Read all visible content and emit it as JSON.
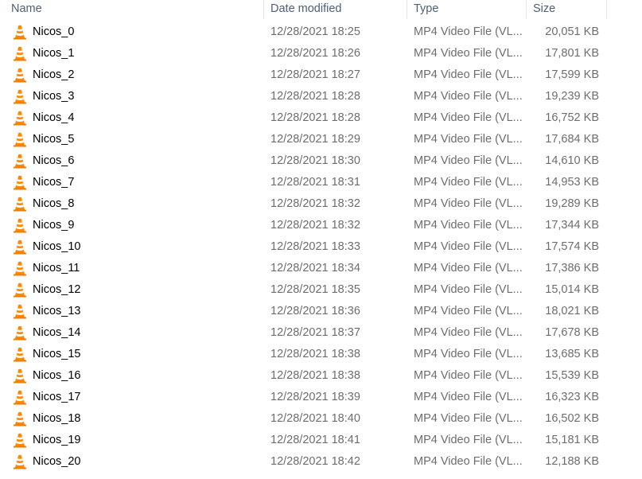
{
  "columns": {
    "name": "Name",
    "date": "Date modified",
    "type": "Type",
    "size": "Size"
  },
  "icon": "vlc-cone-icon",
  "files": [
    {
      "name": "Nicos_0",
      "date": "12/28/2021 18:25",
      "type": "MP4 Video File (VL...",
      "size": "20,051 KB"
    },
    {
      "name": "Nicos_1",
      "date": "12/28/2021 18:26",
      "type": "MP4 Video File (VL...",
      "size": "17,801 KB"
    },
    {
      "name": "Nicos_2",
      "date": "12/28/2021 18:27",
      "type": "MP4 Video File (VL...",
      "size": "17,599 KB"
    },
    {
      "name": "Nicos_3",
      "date": "12/28/2021 18:28",
      "type": "MP4 Video File (VL...",
      "size": "19,239 KB"
    },
    {
      "name": "Nicos_4",
      "date": "12/28/2021 18:28",
      "type": "MP4 Video File (VL...",
      "size": "16,752 KB"
    },
    {
      "name": "Nicos_5",
      "date": "12/28/2021 18:29",
      "type": "MP4 Video File (VL...",
      "size": "17,684 KB"
    },
    {
      "name": "Nicos_6",
      "date": "12/28/2021 18:30",
      "type": "MP4 Video File (VL...",
      "size": "14,610 KB"
    },
    {
      "name": "Nicos_7",
      "date": "12/28/2021 18:31",
      "type": "MP4 Video File (VL...",
      "size": "14,953 KB"
    },
    {
      "name": "Nicos_8",
      "date": "12/28/2021 18:32",
      "type": "MP4 Video File (VL...",
      "size": "19,289 KB"
    },
    {
      "name": "Nicos_9",
      "date": "12/28/2021 18:32",
      "type": "MP4 Video File (VL...",
      "size": "17,344 KB"
    },
    {
      "name": "Nicos_10",
      "date": "12/28/2021 18:33",
      "type": "MP4 Video File (VL...",
      "size": "17,574 KB"
    },
    {
      "name": "Nicos_11",
      "date": "12/28/2021 18:34",
      "type": "MP4 Video File (VL...",
      "size": "17,386 KB"
    },
    {
      "name": "Nicos_12",
      "date": "12/28/2021 18:35",
      "type": "MP4 Video File (VL...",
      "size": "15,014 KB"
    },
    {
      "name": "Nicos_13",
      "date": "12/28/2021 18:36",
      "type": "MP4 Video File (VL...",
      "size": "18,021 KB"
    },
    {
      "name": "Nicos_14",
      "date": "12/28/2021 18:37",
      "type": "MP4 Video File (VL...",
      "size": "17,678 KB"
    },
    {
      "name": "Nicos_15",
      "date": "12/28/2021 18:38",
      "type": "MP4 Video File (VL...",
      "size": "13,685 KB"
    },
    {
      "name": "Nicos_16",
      "date": "12/28/2021 18:38",
      "type": "MP4 Video File (VL...",
      "size": "15,539 KB"
    },
    {
      "name": "Nicos_17",
      "date": "12/28/2021 18:39",
      "type": "MP4 Video File (VL...",
      "size": "16,323 KB"
    },
    {
      "name": "Nicos_18",
      "date": "12/28/2021 18:40",
      "type": "MP4 Video File (VL...",
      "size": "16,502 KB"
    },
    {
      "name": "Nicos_19",
      "date": "12/28/2021 18:41",
      "type": "MP4 Video File (VL...",
      "size": "15,181 KB"
    },
    {
      "name": "Nicos_20",
      "date": "12/28/2021 18:42",
      "type": "MP4 Video File (VL...",
      "size": "12,188 KB"
    }
  ]
}
